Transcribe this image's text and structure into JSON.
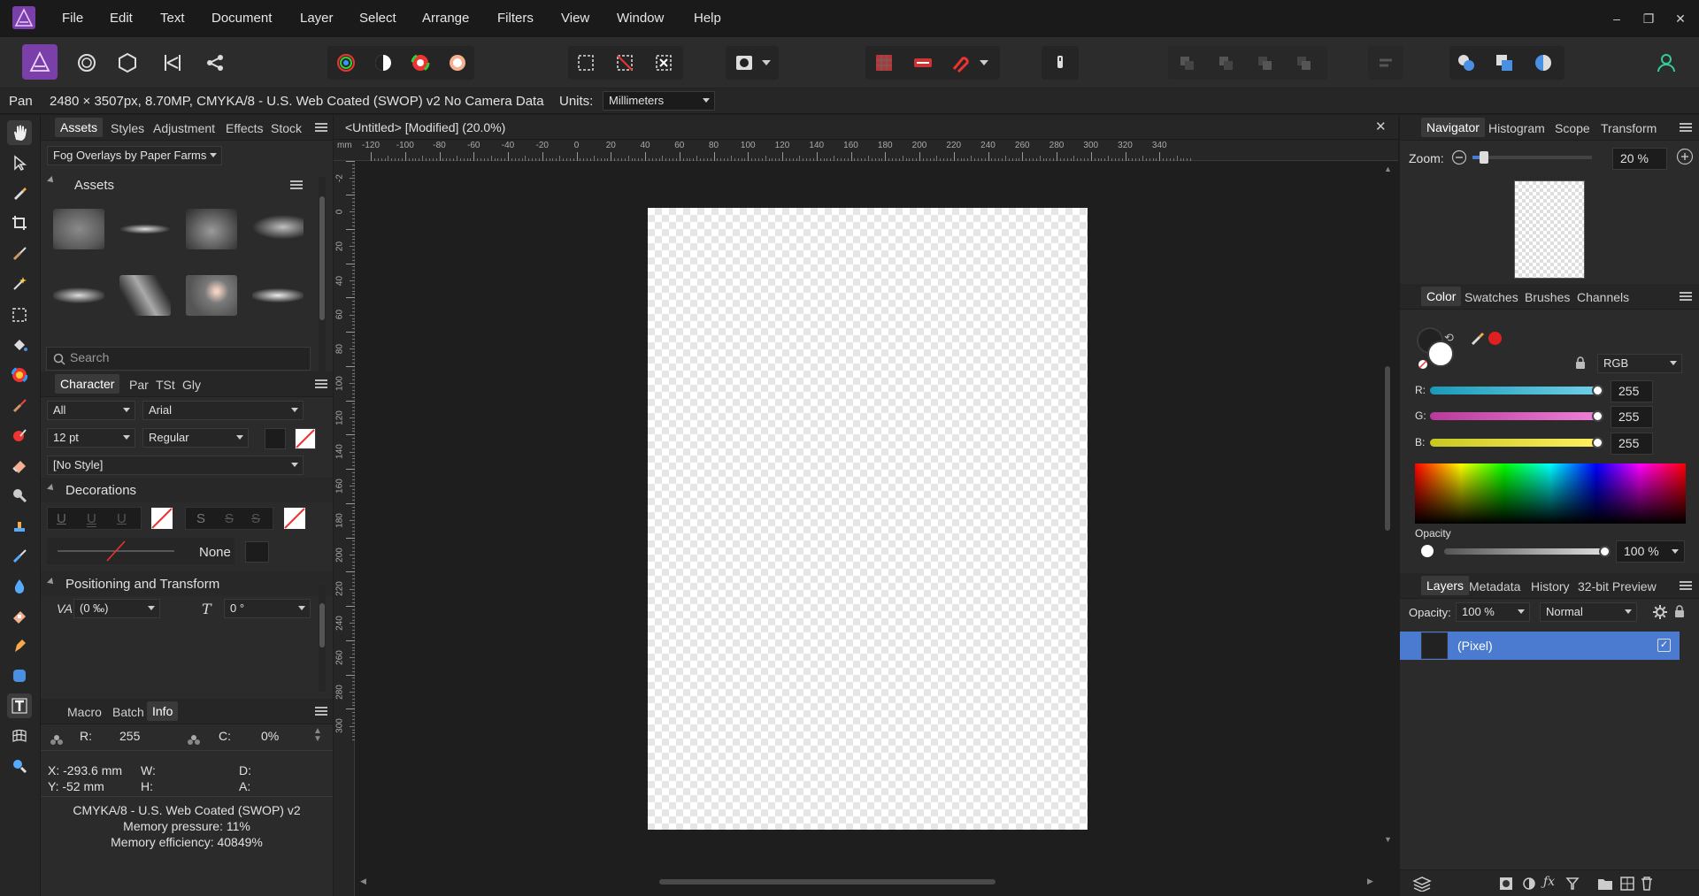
{
  "app": {
    "logo_icon": "affinity-photo-logo",
    "accent": "#4a7bd0"
  },
  "menu": [
    "File",
    "Edit",
    "Text",
    "Document",
    "Layer",
    "Select",
    "Arrange",
    "Filters",
    "View",
    "Window",
    "Help"
  ],
  "window_controls": {
    "minimize": "–",
    "restore": "❐",
    "close": "✕"
  },
  "context": {
    "tool": "Pan",
    "doc_info": "2480 × 3507px, 8.70MP, CMYKA/8 - U.S. Web Coated (SWOP) v2",
    "camera": "No Camera Data",
    "units_label": "Units:",
    "units_value": "Millimeters"
  },
  "left_panel": {
    "tabs": [
      "Assets",
      "Styles",
      "Adjustment",
      "Effects",
      "Stock"
    ],
    "category": "Fog Overlays by Paper Farms",
    "assets_title": "Assets",
    "search_placeholder": "Search",
    "text_tabs": [
      "Character",
      "Par",
      "TSt",
      "Gly"
    ],
    "font_collection": "All",
    "font_family": "Arial",
    "font_size": "12 pt",
    "font_style": "Regular",
    "text_style": "[No Style]",
    "decorations_title": "Decorations",
    "deco_underline": [
      "U",
      "U",
      "U"
    ],
    "deco_strike": [
      "S",
      "S",
      "S"
    ],
    "line_style": "None",
    "positioning_title": "Positioning and Transform",
    "tracking_value": "(0 ‰)",
    "shear_value": "0 °",
    "info_tabs": [
      "Macro",
      "Batch",
      "Info"
    ],
    "info": {
      "r_label": "R:",
      "r_value": "255",
      "c_label": "C:",
      "c_value": "0%",
      "x_label": "X: -293.6 mm",
      "y_label": "Y: -52 mm",
      "w_label": "W:",
      "h_label": "H:",
      "d_label": "D:",
      "a_label": "A:",
      "profile": "CMYKA/8 - U.S. Web Coated (SWOP) v2",
      "memory_pressure": "Memory pressure: 11%",
      "memory_efficiency": "Memory efficiency: 40849%"
    }
  },
  "document": {
    "title": "<Untitled> [Modified] (20.0%)",
    "ruler_unit": "mm",
    "ruler_top": [
      "-120",
      "-100",
      "-80",
      "-60",
      "-40",
      "-20",
      "0",
      "20",
      "40",
      "60",
      "80",
      "100",
      "120",
      "140",
      "160",
      "180",
      "200",
      "220",
      "240",
      "260",
      "280",
      "300",
      "320",
      "340"
    ],
    "ruler_left": [
      "-2",
      "0",
      "20",
      "40",
      "60",
      "80",
      "100",
      "120",
      "140",
      "160",
      "180",
      "200",
      "220",
      "240",
      "260",
      "280",
      "300"
    ]
  },
  "right_panel": {
    "top_tabs": [
      "Navigator",
      "Histogram",
      "Scope",
      "Transform"
    ],
    "zoom_label": "Zoom:",
    "zoom_value": "20 %",
    "color_tabs": [
      "Color",
      "Swatches",
      "Brushes",
      "Channels"
    ],
    "color_model": "RGB",
    "r_label": "R:",
    "g_label": "G:",
    "b_label": "B:",
    "r_value": "255",
    "g_value": "255",
    "b_value": "255",
    "opacity_label": "Opacity",
    "opacity_value": "100 %",
    "layer_tabs": [
      "Layers",
      "Metadata",
      "History",
      "32-bit Preview"
    ],
    "layer_opacity_label": "Opacity:",
    "layer_opacity_value": "100 %",
    "blend_mode": "Normal",
    "layer_name": "(Pixel)",
    "pick_color": "#e02020"
  }
}
